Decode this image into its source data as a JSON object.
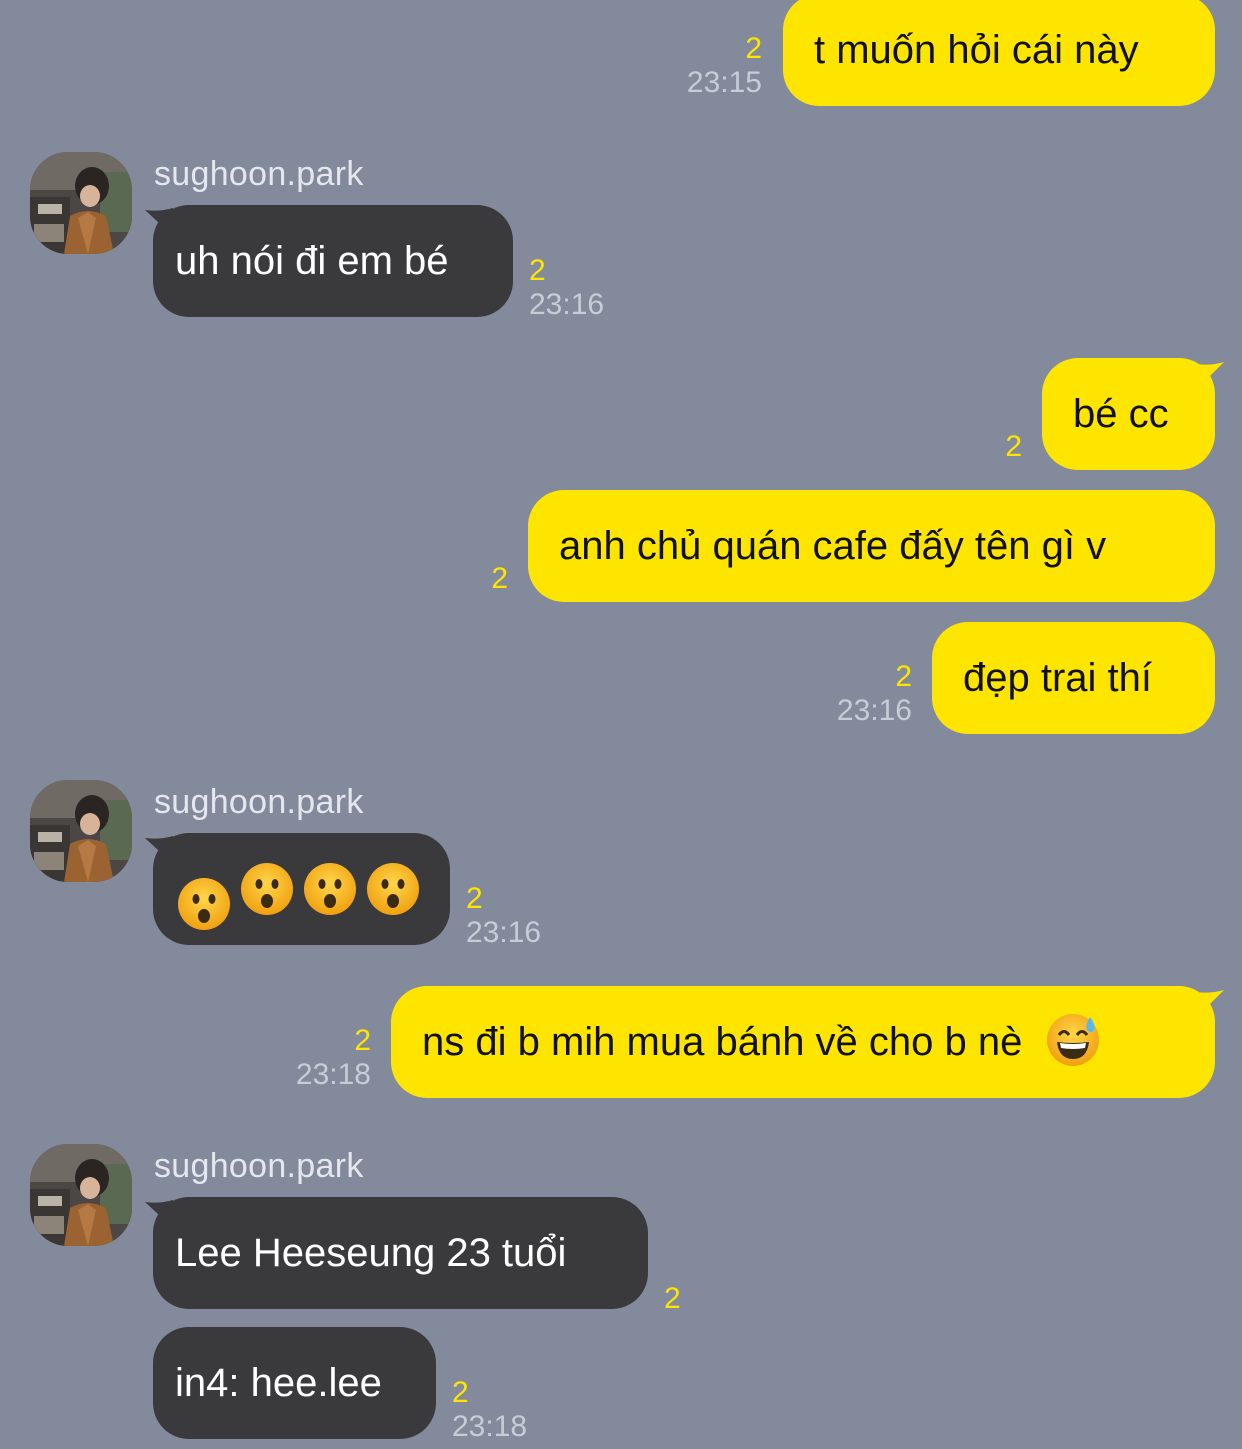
{
  "colors": {
    "background": "#838a9b",
    "outgoing_bubble": "#fee500",
    "incoming_bubble": "#3a3a3c",
    "unread_count": "#fee500",
    "timestamp": "#c8ccd6"
  },
  "messages": [
    {
      "direction": "out",
      "text": "t muốn hỏi cái này",
      "unread": "2",
      "time": "23:15"
    },
    {
      "direction": "in",
      "sender": "sughoon.park",
      "text": "uh nói đi em bé",
      "unread": "2",
      "time": "23:16"
    },
    {
      "direction": "out",
      "text": "bé cc",
      "unread": "2",
      "time": ""
    },
    {
      "direction": "out",
      "text": "anh chủ quán cafe đấy tên gì v",
      "unread": "2",
      "time": ""
    },
    {
      "direction": "out",
      "text": "đẹp trai thí",
      "unread": "2",
      "time": "23:16"
    },
    {
      "direction": "in",
      "sender": "sughoon.park",
      "emojis": [
        "hushed-face-emoji",
        "hushed-face-emoji",
        "hushed-face-emoji",
        "hushed-face-emoji"
      ],
      "unread": "2",
      "time": "23:16"
    },
    {
      "direction": "out",
      "text": "ns đi b mih mua bánh về cho b nè",
      "emoji": "grinning-face-with-sweat-emoji",
      "unread": "2",
      "time": "23:18"
    },
    {
      "direction": "in",
      "sender": "sughoon.park",
      "text": "Lee Heeseung 23 tuổi",
      "unread": "2",
      "time": ""
    },
    {
      "direction": "in",
      "text": "in4: hee.lee",
      "unread": "2",
      "time": "23:18"
    }
  ]
}
